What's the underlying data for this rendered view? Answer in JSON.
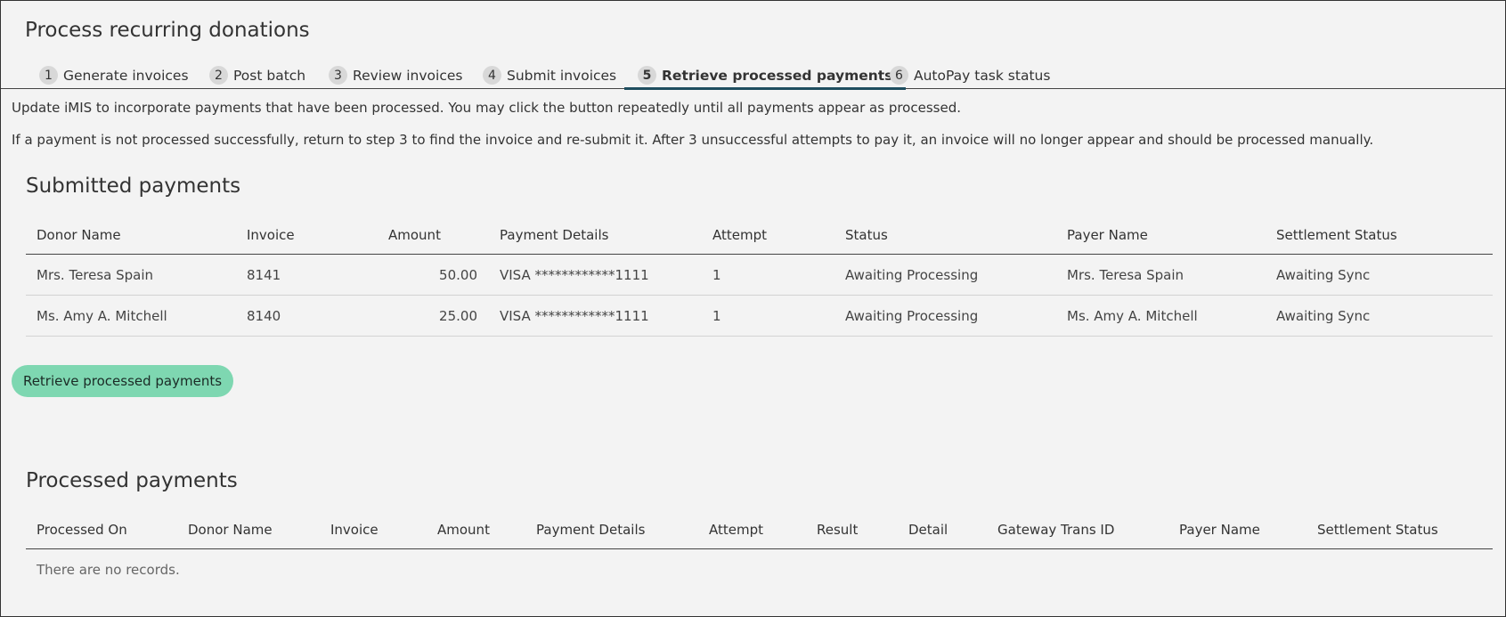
{
  "page": {
    "title": "Process recurring donations"
  },
  "steps": [
    {
      "num": "1",
      "label": "Generate invoices"
    },
    {
      "num": "2",
      "label": "Post batch"
    },
    {
      "num": "3",
      "label": "Review invoices"
    },
    {
      "num": "4",
      "label": "Submit invoices"
    },
    {
      "num": "5",
      "label": "Retrieve processed payments",
      "active": true
    },
    {
      "num": "6",
      "label": "AutoPay task status"
    }
  ],
  "intro": {
    "line1": "Update iMIS to incorporate payments that have been processed. You may click the button repeatedly until all payments appear as processed.",
    "line2": "If a payment is not processed successfully, return to step 3 to find the invoice and re-submit it. After 3 unsuccessful attempts to pay it, an invoice will no longer appear and should be processed manually."
  },
  "submitted": {
    "title": "Submitted payments",
    "columns": [
      "Donor Name",
      "Invoice",
      "Amount",
      "Payment Details",
      "Attempt",
      "Status",
      "Payer Name",
      "Settlement Status"
    ],
    "rows": [
      [
        "Mrs. Teresa Spain",
        "8141",
        "50.00",
        "VISA ************1111",
        "1",
        "Awaiting Processing",
        "Mrs. Teresa Spain",
        "Awaiting Sync"
      ],
      [
        "Ms. Amy A. Mitchell",
        "8140",
        "25.00",
        "VISA ************1111",
        "1",
        "Awaiting Processing",
        "Ms. Amy A. Mitchell",
        "Awaiting Sync"
      ]
    ]
  },
  "retrieve_button": {
    "label": "Retrieve processed payments"
  },
  "processed": {
    "title": "Processed payments",
    "columns": [
      "Processed On",
      "Donor Name",
      "Invoice",
      "Amount",
      "Payment Details",
      "Attempt",
      "Result",
      "Detail",
      "Gateway Trans ID",
      "Payer Name",
      "Settlement Status"
    ],
    "empty_text": "There are no records."
  },
  "colors": {
    "accent_button": "#7ed7b1",
    "active_tab_underline": "#1f4e5f"
  }
}
